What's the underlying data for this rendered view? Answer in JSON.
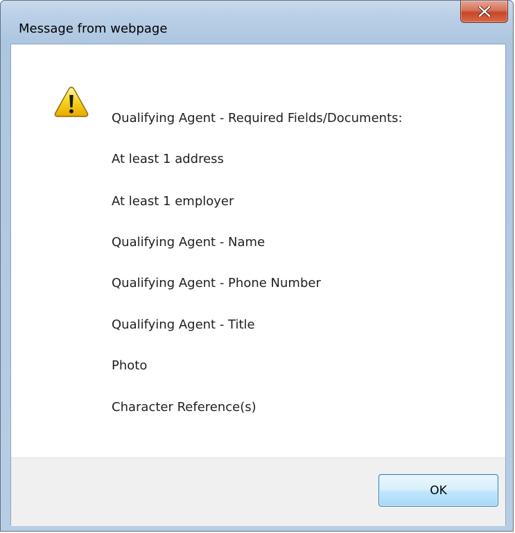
{
  "dialog": {
    "title": "Message from webpage",
    "close_glyph": "x",
    "icon": "warning-icon",
    "message_lines": [
      "Qualifying Agent - Required Fields/Documents:",
      "At least 1 address",
      "At least 1 employer",
      "Qualifying Agent - Name",
      "Qualifying Agent - Phone Number",
      "Qualifying Agent - Title",
      "Photo",
      "Character Reference(s)"
    ],
    "ok_label": "OK"
  },
  "colors": {
    "frame": "#b9cfe6",
    "close_button": "#c7462a",
    "ok_button_border": "#3c7fb1",
    "warning_yellow": "#f5c400"
  }
}
